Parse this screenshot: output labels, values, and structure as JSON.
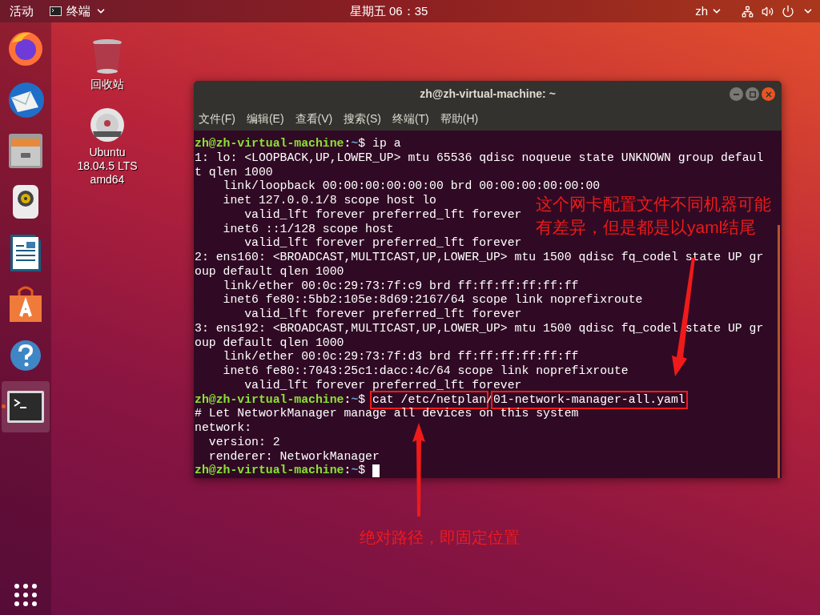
{
  "top_bar": {
    "activities": "活动",
    "app_menu": {
      "label": "终端"
    },
    "clock": "星期五 06：35",
    "input_method": "zh"
  },
  "dock": {
    "items": [
      {
        "kind": "browser",
        "running": false
      },
      {
        "kind": "mail",
        "running": false
      },
      {
        "kind": "files",
        "running": false
      },
      {
        "kind": "music",
        "running": false
      },
      {
        "kind": "document",
        "running": false
      },
      {
        "kind": "store",
        "running": false
      },
      {
        "kind": "help",
        "running": false
      },
      {
        "kind": "terminal",
        "running": true
      }
    ]
  },
  "desktop_icons": [
    {
      "kind": "trash",
      "label_lines": [
        "回收站"
      ]
    },
    {
      "kind": "disc",
      "label_lines": [
        "Ubuntu",
        "18.04.5 LTS",
        "amd64"
      ]
    }
  ],
  "terminal": {
    "title": "zh@zh-virtual-machine: ~",
    "menu": [
      "文件(F)",
      "编辑(E)",
      "查看(V)",
      "搜索(S)",
      "终端(T)",
      "帮助(H)"
    ],
    "lines": [
      {
        "kind": "prompt",
        "user": "zh@zh-virtual-machine",
        "sep": ":",
        "path": "~",
        "symbol": "$ ",
        "command": "ip a"
      },
      {
        "kind": "output",
        "text": "1: lo: <LOOPBACK,UP,LOWER_UP> mtu 65536 qdisc noqueue state UNKNOWN group defaul"
      },
      {
        "kind": "output",
        "text": "t qlen 1000"
      },
      {
        "kind": "output",
        "text": "    link/loopback 00:00:00:00:00:00 brd 00:00:00:00:00:00"
      },
      {
        "kind": "output",
        "text": "    inet 127.0.0.1/8 scope host lo"
      },
      {
        "kind": "output",
        "text": "       valid_lft forever preferred_lft forever"
      },
      {
        "kind": "output",
        "text": "    inet6 ::1/128 scope host"
      },
      {
        "kind": "output",
        "text": "       valid_lft forever preferred_lft forever"
      },
      {
        "kind": "output",
        "text": "2: ens160: <BROADCAST,MULTICAST,UP,LOWER_UP> mtu 1500 qdisc fq_codel state UP gr"
      },
      {
        "kind": "output",
        "text": "oup default qlen 1000"
      },
      {
        "kind": "output",
        "text": "    link/ether 00:0c:29:73:7f:c9 brd ff:ff:ff:ff:ff:ff"
      },
      {
        "kind": "output",
        "text": "    inet6 fe80::5bb2:105e:8d69:2167/64 scope link noprefixroute"
      },
      {
        "kind": "output",
        "text": "       valid_lft forever preferred_lft forever"
      },
      {
        "kind": "output",
        "text": "3: ens192: <BROADCAST,MULTICAST,UP,LOWER_UP> mtu 1500 qdisc fq_codel state UP gr"
      },
      {
        "kind": "output",
        "text": "oup default qlen 1000"
      },
      {
        "kind": "output",
        "text": "    link/ether 00:0c:29:73:7f:d3 brd ff:ff:ff:ff:ff:ff"
      },
      {
        "kind": "output",
        "text": "    inet6 fe80::7043:25c1:dacc:4c/64 scope link noprefixroute"
      },
      {
        "kind": "output",
        "text": "       valid_lft forever preferred_lft forever"
      },
      {
        "kind": "prompt",
        "user": "zh@zh-virtual-machine",
        "sep": ":",
        "path": "~",
        "symbol": "$ ",
        "command_parts": [
          {
            "text": "cat /etc/netplan",
            "highlighted": true
          },
          {
            "text": "/",
            "highlighted": false
          },
          {
            "text": "01-network-manager-all.yaml",
            "highlighted": true
          }
        ]
      },
      {
        "kind": "output",
        "text": "# Let NetworkManager manage all devices on this system"
      },
      {
        "kind": "output",
        "text": "network:"
      },
      {
        "kind": "output",
        "text": "  version: 2"
      },
      {
        "kind": "output",
        "text": "  renderer: NetworkManager"
      },
      {
        "kind": "prompt",
        "user": "zh@zh-virtual-machine",
        "sep": ":",
        "path": "~",
        "symbol": "$ ",
        "cursor": true
      }
    ]
  },
  "annotations": [
    {
      "kind": "file-note",
      "text": "这个网卡配置文件不同机器可能有差异，但是都是以yaml结尾"
    },
    {
      "kind": "path-note",
      "text": "绝对路径，即固定位置"
    }
  ]
}
